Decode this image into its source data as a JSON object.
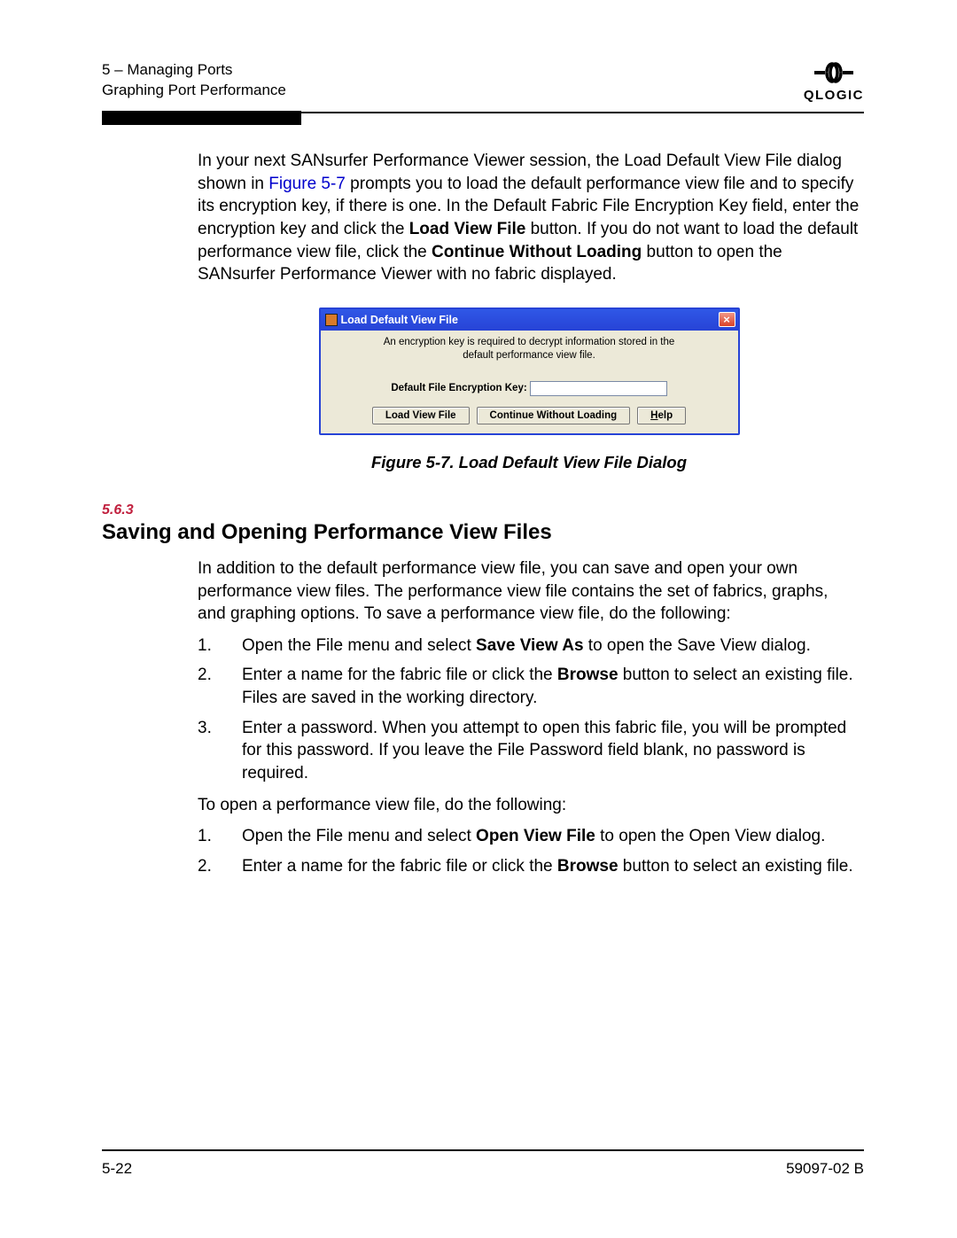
{
  "header": {
    "chapter": "5 – Managing Ports",
    "section": "Graphing Port Performance",
    "logo_mark": "⧐Ɔ",
    "logo_text": "QLOGIC"
  },
  "intro": {
    "t1": "In your next SANsurfer Performance Viewer session, the Load Default View File dialog shown in ",
    "xref": "Figure 5-7",
    "t2": " prompts you to load the default performance view file and to specify its encryption key, if there is one. In the Default Fabric File Encryption Key field, enter the encryption key and click the ",
    "b1": "Load View File",
    "t3": " button. If you do not want to load the default performance view file, click the ",
    "b2": "Continue Without Loading",
    "t4": " button to open the SANsurfer Performance Viewer with no fabric displayed."
  },
  "dialog": {
    "title": "Load Default View File",
    "message": "An encryption key is required to decrypt information stored in the default performance view file.",
    "key_label": "Default File Encryption Key:",
    "btn_load": "Load View File",
    "btn_continue": "Continue Without Loading",
    "btn_help_u": "H",
    "btn_help_rest": "elp",
    "close": "×"
  },
  "figcaption": "Figure 5-7.  Load Default View File Dialog",
  "section_num": "5.6.3",
  "section_title": "Saving and Opening Performance View Files",
  "sect_para": "In addition to the default performance view file, you can save and open your own performance view files. The performance view file contains the set of fabrics, graphs, and graphing options. To save a performance view file, do the following:",
  "save_steps": [
    {
      "n": "1.",
      "pre": "Open the File menu and select ",
      "b": "Save View As",
      "post": " to open the Save View dialog."
    },
    {
      "n": "2.",
      "pre": "Enter a name for the fabric file or click the ",
      "b": "Browse",
      "post": " button to select an existing file. Files are saved in the working directory."
    },
    {
      "n": "3.",
      "pre": "Enter a password. When you attempt to open this fabric file, you will be prompted for this password. If you leave the File Password field blank, no password is required.",
      "b": "",
      "post": ""
    }
  ],
  "open_para": "To open a performance view file, do the following:",
  "open_steps": [
    {
      "n": "1.",
      "pre": "Open the File menu and select ",
      "b": "Open View File",
      "post": " to open the Open View dialog."
    },
    {
      "n": "2.",
      "pre": "Enter a name for the fabric file or click the ",
      "b": "Browse",
      "post": " button to select an existing file."
    }
  ],
  "footer": {
    "left": "5-22",
    "right": "59097-02 B"
  }
}
